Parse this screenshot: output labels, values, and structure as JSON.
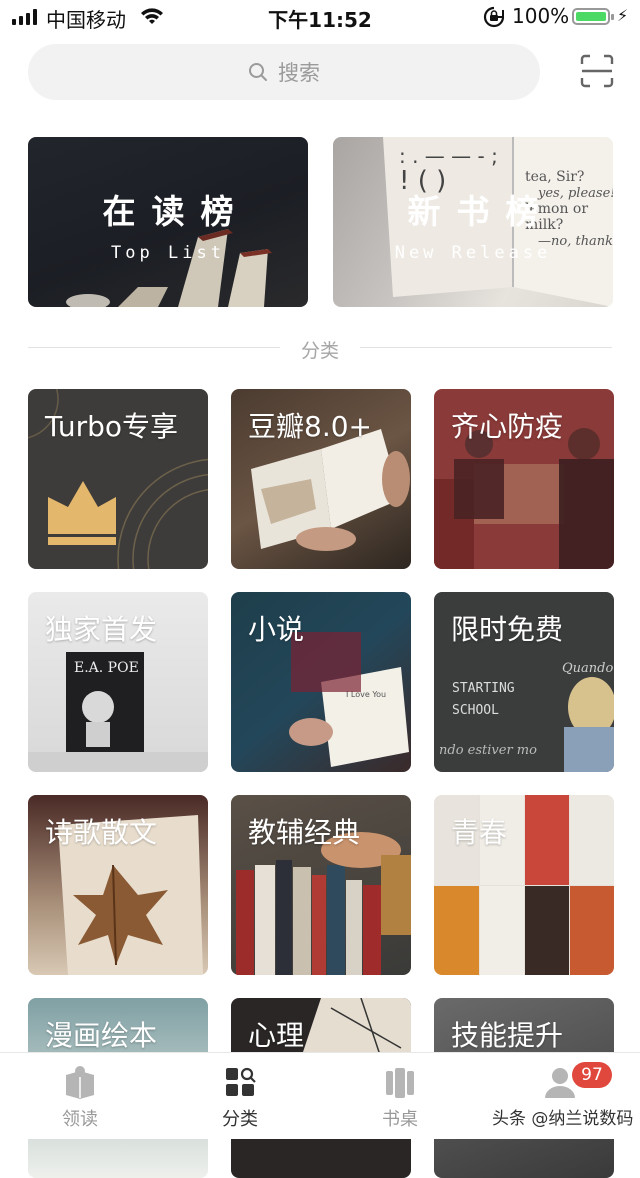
{
  "status_bar": {
    "carrier": "中国移动",
    "time": "下午11:52",
    "battery_percent": "100%",
    "battery_level": 1.0,
    "battery_color": "#4cd964"
  },
  "search": {
    "placeholder": "搜索",
    "icon": "search-icon",
    "scan_icon": "scan-icon"
  },
  "rankings": [
    {
      "title": "在读榜",
      "subtitle": "Top List"
    },
    {
      "title": "新书榜",
      "subtitle": "New Release"
    }
  ],
  "section_title": "分类",
  "categories": [
    {
      "label": "Turbo专享"
    },
    {
      "label": "豆瓣8.0+"
    },
    {
      "label": "齐心防疫"
    },
    {
      "label": "独家首发"
    },
    {
      "label": "小说"
    },
    {
      "label": "限时免费"
    },
    {
      "label": "诗歌散文"
    },
    {
      "label": "教辅经典"
    },
    {
      "label": "青春"
    },
    {
      "label": "漫画绘本"
    },
    {
      "label": "心理"
    },
    {
      "label": "技能提升"
    }
  ],
  "tabbar": {
    "items": [
      {
        "label": "领读",
        "icon": "book-icon",
        "active": false
      },
      {
        "label": "分类",
        "icon": "category-icon",
        "active": true
      },
      {
        "label": "书桌",
        "icon": "bookshelf-icon",
        "active": false
      },
      {
        "label": "",
        "icon": "profile-icon",
        "active": false
      }
    ],
    "badge_count": "97",
    "badge_color": "#e0483e"
  },
  "watermark": "头条 @纳兰说数码"
}
